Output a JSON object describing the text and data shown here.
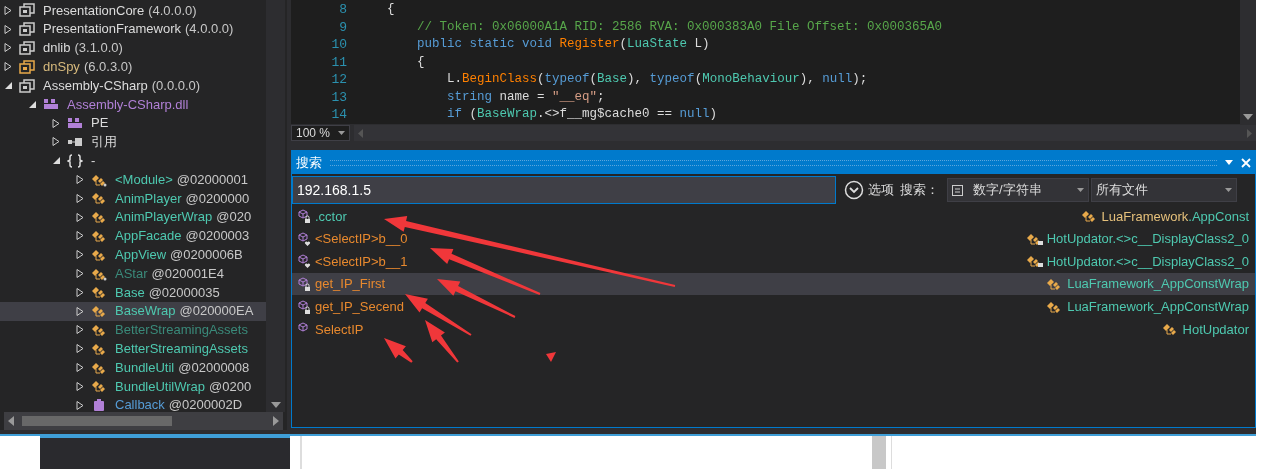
{
  "tree": [
    {
      "label": "PresentationCore",
      "version": "(4.0.0.0)",
      "kind": "assembly",
      "expanded": false,
      "selected": false
    },
    {
      "label": "PresentationFramework",
      "version": "(4.0.0.0)",
      "kind": "assembly",
      "expanded": false,
      "selected": false
    },
    {
      "label": "dnlib",
      "version": "(3.1.0.0)",
      "kind": "assembly",
      "expanded": false,
      "selected": false
    },
    {
      "label": "dnSpy",
      "version": "(6.0.3.0)",
      "kind": "assembly-highlight",
      "expanded": false,
      "selected": false
    },
    {
      "label": "Assembly-CSharp",
      "version": "(0.0.0.0)",
      "kind": "assembly",
      "expanded": true,
      "selected": false,
      "children": [
        {
          "label": "Assembly-CSharp.dll",
          "kind": "dll",
          "expanded": true,
          "selected": false,
          "children": [
            {
              "label": "PE",
              "kind": "module",
              "expanded": false,
              "selected": false
            },
            {
              "label": "引用",
              "kind": "references",
              "expanded": false,
              "selected": false
            },
            {
              "label": "-",
              "kind": "namespace",
              "expanded": true,
              "selected": false,
              "children": [
                {
                  "label": "<Module>",
                  "version": "@02000001",
                  "kind": "type-static",
                  "expanded": false,
                  "selected": false
                },
                {
                  "label": "AnimPlayer",
                  "version": "@0200000",
                  "kind": "type",
                  "expanded": false,
                  "selected": false
                },
                {
                  "label": "AnimPlayerWrap",
                  "version": "@020",
                  "kind": "type",
                  "expanded": false,
                  "selected": false
                },
                {
                  "label": "AppFacade",
                  "version": "@0200003",
                  "kind": "type",
                  "expanded": false,
                  "selected": false
                },
                {
                  "label": "AppView",
                  "version": "@0200006B",
                  "kind": "type",
                  "expanded": false,
                  "selected": false
                },
                {
                  "label": "AStar",
                  "version": "@020001E4",
                  "kind": "type-static-dim",
                  "expanded": false,
                  "selected": false
                },
                {
                  "label": "Base",
                  "version": "@02000035",
                  "kind": "type",
                  "expanded": false,
                  "selected": false
                },
                {
                  "label": "BaseWrap",
                  "version": "@020000EA",
                  "kind": "type",
                  "expanded": false,
                  "selected": true
                },
                {
                  "label": "BetterStreamingAssets",
                  "kind": "type-dim",
                  "expanded": false,
                  "selected": false
                },
                {
                  "label": "BetterStreamingAssets",
                  "kind": "type",
                  "expanded": false,
                  "selected": false
                },
                {
                  "label": "BundleUtil",
                  "version": "@02000008",
                  "kind": "type",
                  "expanded": false,
                  "selected": false
                },
                {
                  "label": "BundleUtilWrap",
                  "version": "@0200",
                  "kind": "type",
                  "expanded": false,
                  "selected": false
                },
                {
                  "label": "Callback",
                  "version": "@0200002D",
                  "kind": "delegate",
                  "expanded": false,
                  "selected": false
                }
              ]
            }
          ]
        }
      ]
    }
  ],
  "code": {
    "lines": [
      {
        "number": "8",
        "tokens": [
          {
            "kind": "plain",
            "text": "{"
          }
        ]
      },
      {
        "number": "9",
        "tokens": [
          {
            "kind": "comment",
            "text": "    // Token: 0x06000A1A RID: 2586 RVA: 0x000383A0 File Offset: 0x000365A0"
          }
        ]
      },
      {
        "number": "10",
        "tokens": [
          {
            "kind": "keyword",
            "text": "    public static void "
          },
          {
            "kind": "method",
            "text": "Register"
          },
          {
            "kind": "plain",
            "text": "("
          },
          {
            "kind": "type",
            "text": "LuaState"
          },
          {
            "kind": "plain",
            "text": " L)"
          }
        ]
      },
      {
        "number": "11",
        "tokens": [
          {
            "kind": "plain",
            "text": "    {"
          }
        ]
      },
      {
        "number": "12",
        "tokens": [
          {
            "kind": "plain",
            "text": "        L."
          },
          {
            "kind": "method",
            "text": "BeginClass"
          },
          {
            "kind": "plain",
            "text": "("
          },
          {
            "kind": "keyword",
            "text": "typeof"
          },
          {
            "kind": "plain",
            "text": "("
          },
          {
            "kind": "type",
            "text": "Base"
          },
          {
            "kind": "plain",
            "text": "), "
          },
          {
            "kind": "keyword",
            "text": "typeof"
          },
          {
            "kind": "plain",
            "text": "("
          },
          {
            "kind": "type",
            "text": "MonoBehaviour"
          },
          {
            "kind": "plain",
            "text": "), "
          },
          {
            "kind": "keyword",
            "text": "null"
          },
          {
            "kind": "plain",
            "text": ");"
          }
        ]
      },
      {
        "number": "13",
        "tokens": [
          {
            "kind": "keyword",
            "text": "        string"
          },
          {
            "kind": "plain",
            "text": " name = "
          },
          {
            "kind": "string",
            "text": "\"__eq\""
          },
          {
            "kind": "plain",
            "text": ";"
          }
        ]
      },
      {
        "number": "14",
        "tokens": [
          {
            "kind": "keyword",
            "text": "        if"
          },
          {
            "kind": "plain",
            "text": " ("
          },
          {
            "kind": "type",
            "text": "BaseWrap"
          },
          {
            "kind": "plain",
            "text": ".<>f__mg$cache0 == "
          },
          {
            "kind": "keyword",
            "text": "null"
          },
          {
            "kind": "plain",
            "text": ")"
          }
        ]
      }
    ],
    "zoom": "100 %"
  },
  "search": {
    "title": "搜索",
    "query": "192.168.1.5",
    "options_label": "选项",
    "search_label": "搜索：",
    "type_dropdown": "数字/字符串",
    "scope_dropdown": "所有文件",
    "results": [
      {
        "name": ".cctor",
        "kind": "private-constructor",
        "selected": false,
        "location": [
          {
            "kind": "namespace",
            "text": "LuaFramework"
          },
          {
            "kind": "type",
            "text": ".AppConst"
          }
        ]
      },
      {
        "name": "<SelectIP>b__0",
        "kind": "internal-method",
        "selected": false,
        "location": [
          {
            "kind": "private-type",
            "text": "HotUpdator.<>c__DisplayClass2_0"
          }
        ]
      },
      {
        "name": "<SelectIP>b__1",
        "kind": "internal-method",
        "selected": false,
        "location": [
          {
            "kind": "private-type",
            "text": "HotUpdator.<>c__DisplayClass2_0"
          }
        ]
      },
      {
        "name": "get_IP_First",
        "kind": "private-method",
        "selected": true,
        "location": [
          {
            "kind": "type",
            "text": "LuaFramework_AppConstWrap"
          }
        ]
      },
      {
        "name": "get_IP_Secend",
        "kind": "private-method",
        "selected": false,
        "location": [
          {
            "kind": "type",
            "text": "LuaFramework_AppConstWrap"
          }
        ]
      },
      {
        "name": "SelectIP",
        "kind": "public-method",
        "selected": false,
        "location": [
          {
            "kind": "type",
            "text": "HotUpdator"
          }
        ]
      }
    ]
  }
}
